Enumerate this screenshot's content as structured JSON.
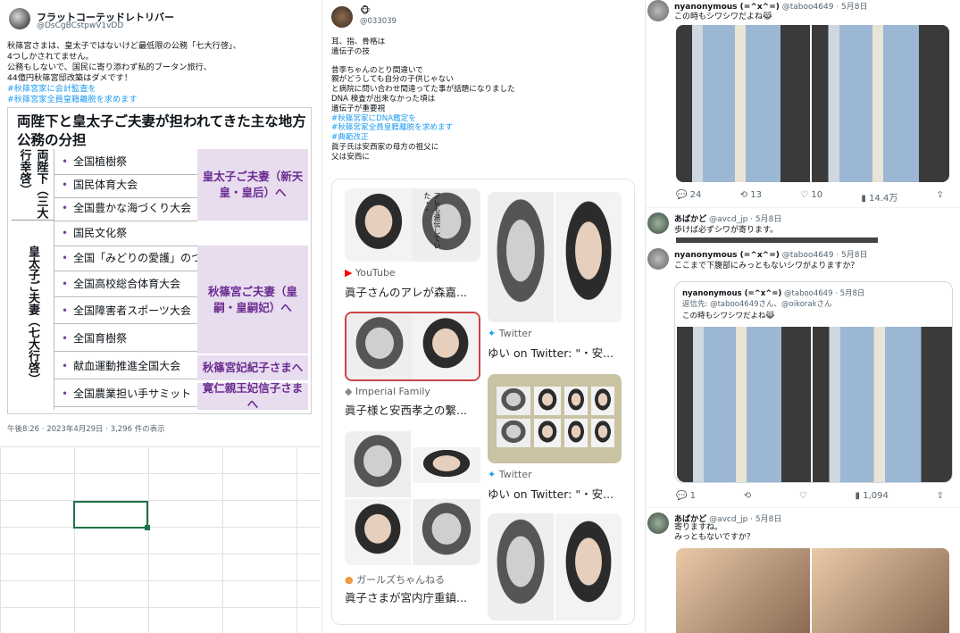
{
  "left_tweet": {
    "display_name": "フラットコーテッドレトリバー",
    "handle": "@DsCgBCstpwV1vDD",
    "text_lines": [
      "秋篠宮さまは、皇太子ではないけど最低限の公務「七大行啓」、",
      "4つしかされてません。",
      "公務もしないで、国民に寄り添わず私的ブータン旅行、",
      "44億円秋篠宮邸改築はダメです！"
    ],
    "hashtags": [
      "#秋篠宮家に会計監査を",
      "#秋篠宮家全員皇籍離脱を求めます"
    ],
    "image": {
      "title": "両陛下と皇太子ご夫妻が担われてきた主な地方公務の分担",
      "group1": "両陛下（三大行幸啓）",
      "group2": "皇太子ご夫妻（七大行啓）",
      "rows": [
        "全国植樹祭",
        "国民体育大会",
        "全国豊かな海づくり大会",
        "国民文化祭",
        "全国「みどりの愛護」のつどい",
        "全国高校総合体育大会",
        "全国障害者スポーツ大会",
        "全国育樹祭",
        "献血運動推進全国大会",
        "全国農業担い手サミット"
      ],
      "purple_labels": [
        "皇太子ご夫妻（新天皇・皇后）へ",
        "秋篠宮ご夫妻（皇嗣・皇嗣妃）へ",
        "秋篠宮妃紀子さまへ",
        "寛仁親王妃信子さまへ"
      ]
    },
    "meta": "午後8:26 · 2023年4月29日 · 3,296 件の表示"
  },
  "middle_tweet": {
    "display_name": "🐵",
    "handle": "@033039",
    "text_lines": [
      "耳、指、骨格は",
      "遺伝子の技",
      "",
      "昔李ちゃんのとり間違いで",
      "親がどうしても自分の子供じゃない",
      "と病院に問い合わせ間違ってた事が話題になりました",
      "DNA 検査が出来なかった頃は",
      "遺伝子が重要視"
    ],
    "hashtags": [
      "#秋篠宮家にDNA鑑定を",
      "#秋篠宮家全員皇籍離脱を求めます",
      "#典範改正"
    ],
    "text_lines_2": [
      "眞子氏は安西家の母方の祖父に",
      "父は安西に"
    ],
    "results": [
      {
        "source": "YouTube",
        "caption": "眞子さんのアレが森嘉..."
      },
      {
        "source": "Twitter",
        "caption": "ゆい on Twitter: \"・安..."
      },
      {
        "source": "Imperial Family",
        "caption": "眞子様と安西孝之の繋..."
      },
      {
        "source": "Twitter",
        "caption": "ゆい on Twitter: \"・安..."
      },
      {
        "source": "ガールズちゃんねる",
        "caption": "眞子さまが宮内庁重鎮..."
      }
    ],
    "overlay_text": "アレも遺伝していた・・"
  },
  "right_thread": {
    "tweet1": {
      "name": "nyanonymous (=^x^=)",
      "handle": "@taboo4649 · 5月8日",
      "text": "この時もシワシワだよね😹",
      "stats": [
        "24",
        "13",
        "10",
        "14.4万"
      ]
    },
    "reply1": {
      "name": "あばかど",
      "handle": "@avcd_jp · 5月8日",
      "text": "歩けば必ずシワが寄ります。"
    },
    "tweet2": {
      "name": "nyanonymous (=^x^=)",
      "handle": "@taboo4649 · 5月8日",
      "text": "ここまで下腹部にみっともないシワがよりますか？",
      "quote": {
        "name": "nyanonymous (=^x^=)",
        "handle": "@taboo4649 · 5月8日",
        "reply_to": "返信先: @taboo4649さん、@oikorakさん",
        "text": "この時もシワシワだよね😹"
      },
      "stats": [
        "1",
        "",
        "",
        "1,094"
      ]
    },
    "reply2": {
      "name": "あばかど",
      "handle": "@avcd_jp · 5月8日",
      "text_lines": [
        "寄りますね。",
        "みっともないですか？"
      ]
    }
  }
}
